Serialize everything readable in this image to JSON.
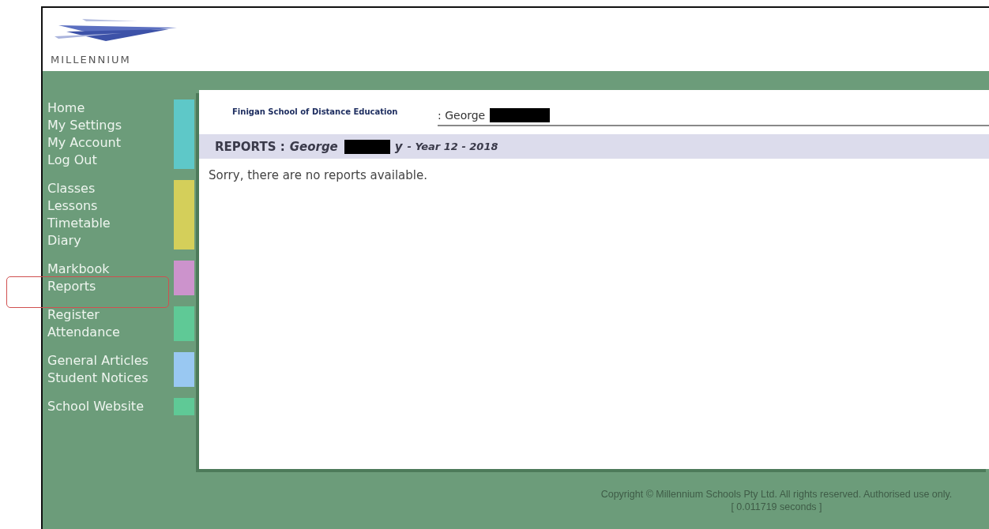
{
  "logo": {
    "text": "MILLENNIUM"
  },
  "nav_groups": [
    {
      "color": "#5ec8c8",
      "items": [
        {
          "label": "Home",
          "highlighted": false
        },
        {
          "label": "My Settings",
          "highlighted": false
        },
        {
          "label": "My Account",
          "highlighted": false
        },
        {
          "label": "Log Out",
          "highlighted": false
        }
      ]
    },
    {
      "color": "#d4cf5a",
      "items": [
        {
          "label": "Classes",
          "highlighted": false
        },
        {
          "label": "Lessons",
          "highlighted": false
        },
        {
          "label": "Timetable",
          "highlighted": false
        },
        {
          "label": "Diary",
          "highlighted": false
        }
      ]
    },
    {
      "color": "#cc93cc",
      "items": [
        {
          "label": "Markbook",
          "highlighted": false
        },
        {
          "label": "Reports",
          "highlighted": true
        }
      ]
    },
    {
      "color": "#5fc996",
      "items": [
        {
          "label": "Register",
          "highlighted": false
        },
        {
          "label": "Attendance",
          "highlighted": false
        }
      ]
    },
    {
      "color": "#99c8f2",
      "items": [
        {
          "label": "General Articles",
          "highlighted": false
        },
        {
          "label": "Student Notices",
          "highlighted": false
        }
      ]
    },
    {
      "color": "#5fc996",
      "items": [
        {
          "label": "School Website",
          "highlighted": false
        }
      ]
    }
  ],
  "school_name": "Finigan School of Distance Education",
  "user_name": ": George",
  "heading": {
    "title": "REPORTS :",
    "name_start": "George",
    "name_end": "y",
    "detail": "- Year 12 - 2018"
  },
  "message": "Sorry, there are no reports available.",
  "footer": {
    "copyright": "Copyright © Millennium Schools Pty Ltd. All rights reserved. Authorised use only.",
    "timing": "[ 0.011719 seconds ]"
  }
}
